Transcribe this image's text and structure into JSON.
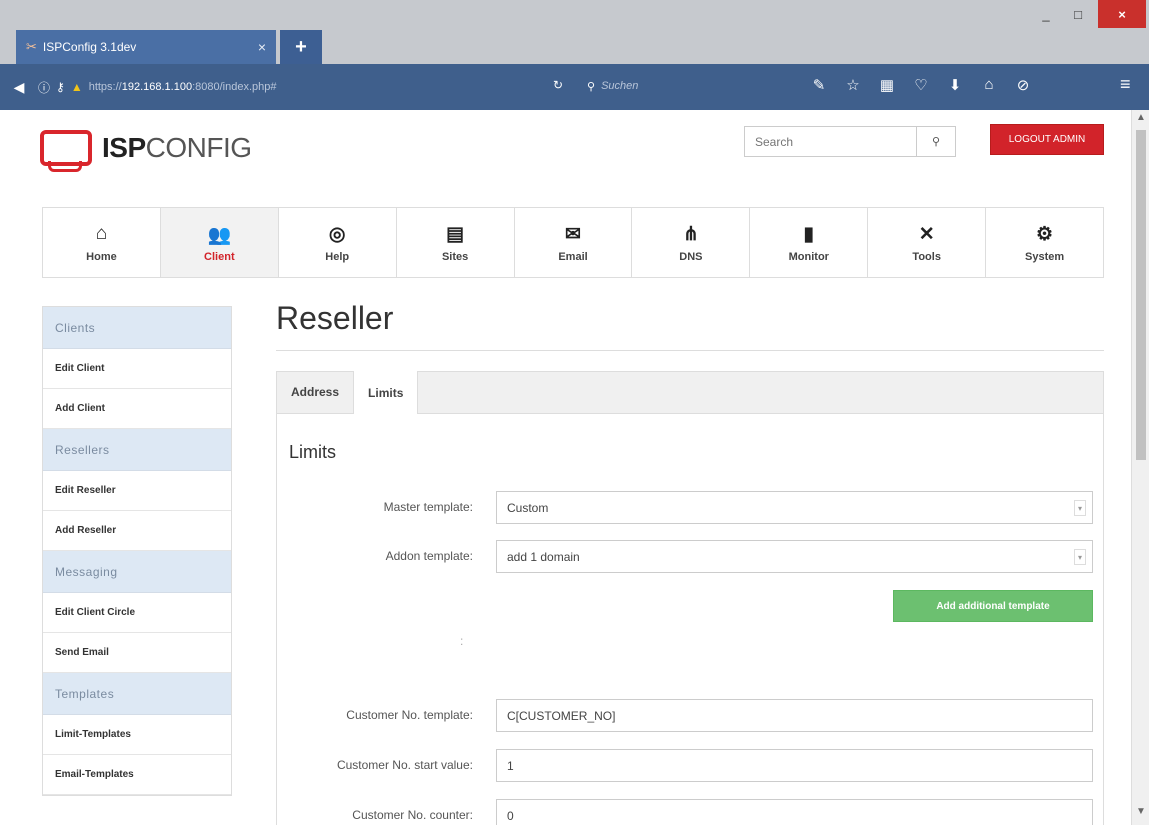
{
  "browser": {
    "tab_title": "ISPConfig 3.1dev",
    "tab_close": "×",
    "new_tab": "+",
    "win_min": "_",
    "win_max": "□",
    "win_close": "×",
    "url_prefix": "https://",
    "url_host": "192.168.1.100",
    "url_suffix": ":8080/index.php#",
    "search_placeholder": "Suchen"
  },
  "header": {
    "logo_bold": "ISP",
    "logo_rest": "CONFIG",
    "search_placeholder": "Search",
    "logout_label": "LOGOUT ADMIN"
  },
  "mainnav": [
    {
      "label": "Home",
      "icon": "home-icon",
      "glyph": "🏠"
    },
    {
      "label": "Client",
      "icon": "users-icon",
      "glyph": "👥"
    },
    {
      "label": "Help",
      "icon": "lifebuoy-icon",
      "glyph": "◎"
    },
    {
      "label": "Sites",
      "icon": "browser-icon",
      "glyph": "▤"
    },
    {
      "label": "Email",
      "icon": "envelope-icon",
      "glyph": "✉"
    },
    {
      "label": "DNS",
      "icon": "sitemap-icon",
      "glyph": "⋔"
    },
    {
      "label": "Monitor",
      "icon": "traffic-light-icon",
      "glyph": "⚝"
    },
    {
      "label": "Tools",
      "icon": "tools-icon",
      "glyph": "✕"
    },
    {
      "label": "System",
      "icon": "gear-icon",
      "glyph": "⚙"
    }
  ],
  "sidebar": {
    "clients_head": "Clients",
    "edit_client": "Edit Client",
    "add_client": "Add Client",
    "resellers_head": "Resellers",
    "edit_reseller": "Edit Reseller",
    "add_reseller": "Add Reseller",
    "messaging_head": "Messaging",
    "edit_circle": "Edit Client Circle",
    "send_email": "Send Email",
    "templates_head": "Templates",
    "limit_templates": "Limit-Templates",
    "email_templates": "Email-Templates"
  },
  "main": {
    "title": "Reseller",
    "tab_address": "Address",
    "tab_limits": "Limits",
    "section_title": "Limits",
    "master_label": "Master template:",
    "master_value": "Custom",
    "addon_label": "Addon template:",
    "addon_value": "add 1 domain",
    "add_template_btn": "Add additional template",
    "colon": ":",
    "cust_tpl_label": "Customer No. template:",
    "cust_tpl_value": "C[CUSTOMER_NO]",
    "cust_start_label": "Customer No. start value:",
    "cust_start_value": "1",
    "cust_counter_label": "Customer No. counter:",
    "cust_counter_value": "0"
  },
  "colors": {
    "accent_red": "#d2232a",
    "browser_blue": "#3f5f8c",
    "sidebar_head_bg": "#dde8f4",
    "green_button": "#6cc070"
  }
}
